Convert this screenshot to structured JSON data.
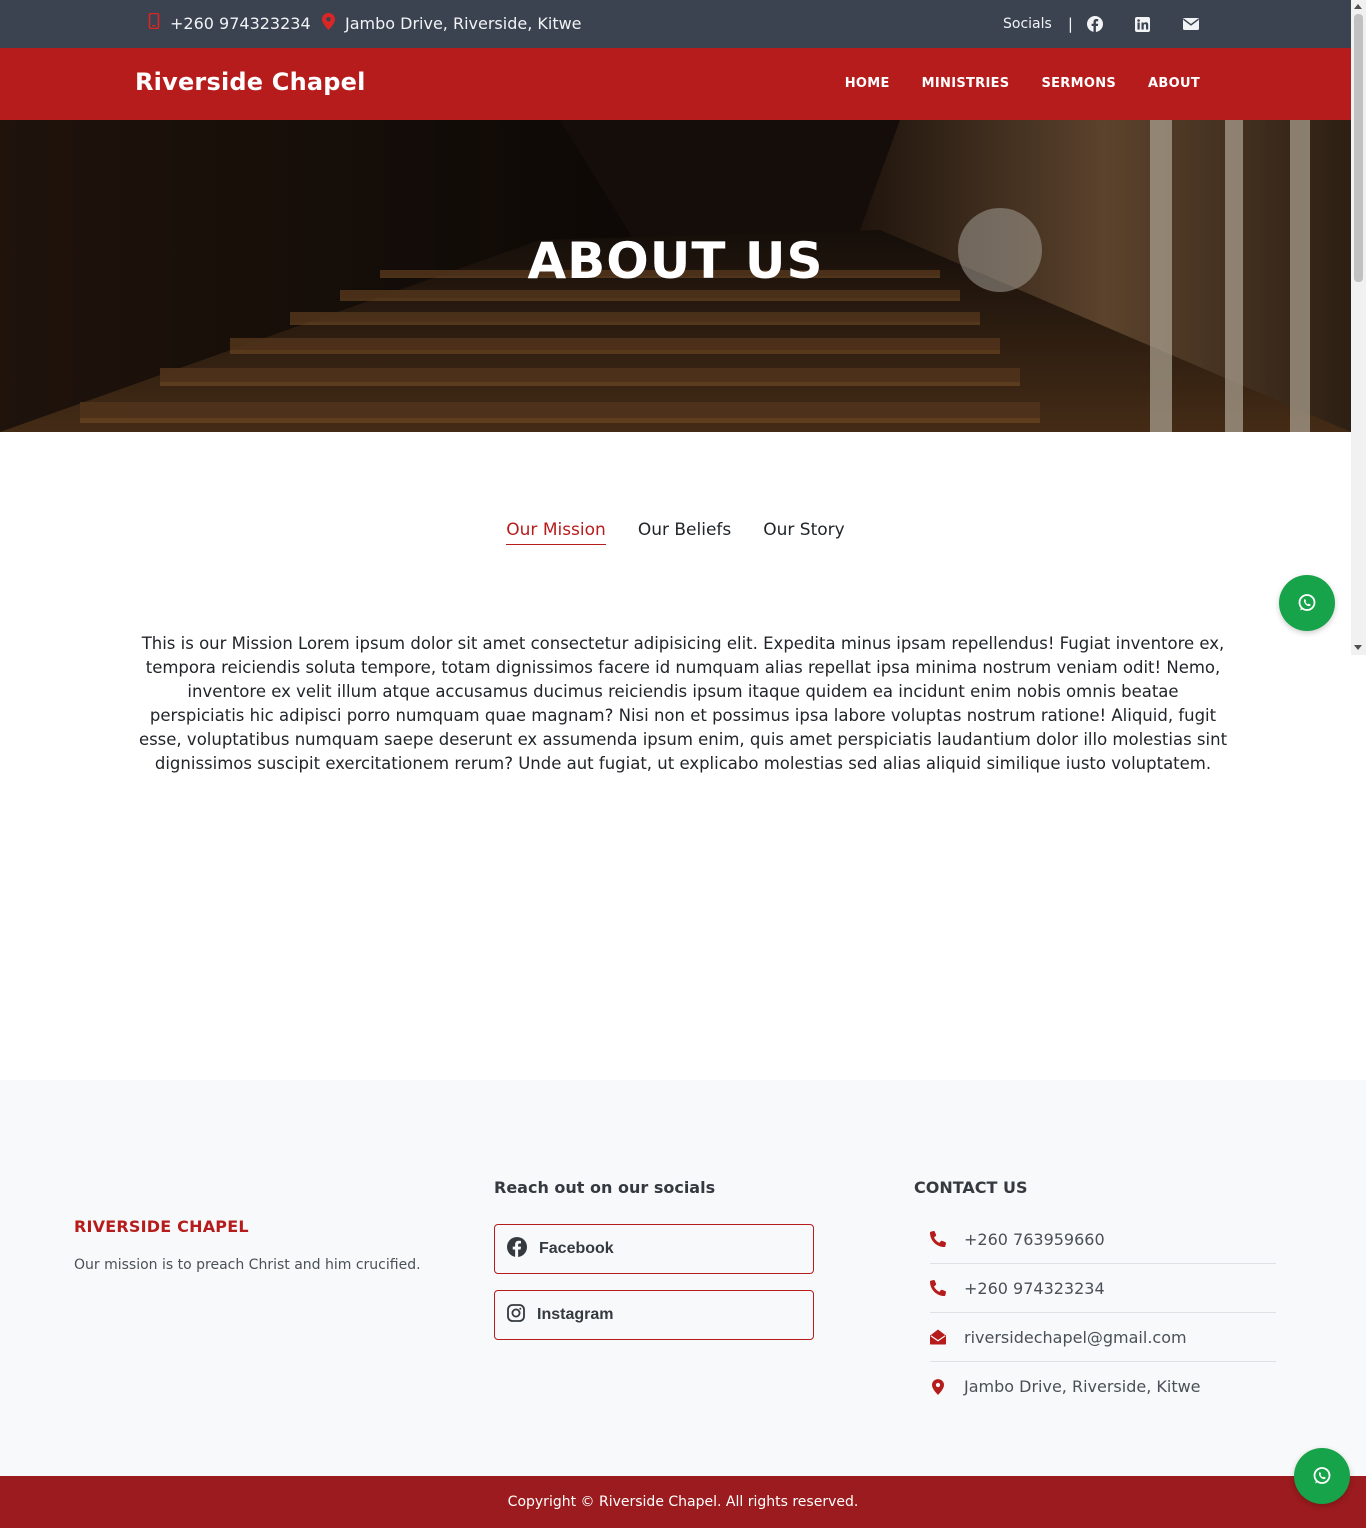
{
  "topbar": {
    "phone": "+260 974323234",
    "address": "Jambo Drive, Riverside, Kitwe",
    "socials_label": "Socials",
    "separator": "|",
    "icons": [
      "facebook-icon",
      "linkedin-icon",
      "envelope-icon"
    ]
  },
  "navbar": {
    "brand": "Riverside Chapel",
    "links": [
      "HOME",
      "MINISTRIES",
      "SERMONS",
      "ABOUT"
    ]
  },
  "hero": {
    "title": "ABOUT US"
  },
  "tabs": {
    "items": [
      "Our Mission",
      "Our Beliefs",
      "Our Story"
    ],
    "active": "Our Mission"
  },
  "mission_text": "This is our Mission Lorem ipsum dolor sit amet consectetur adipisicing elit. Expedita minus ipsam repellendus! Fugiat inventore ex, tempora reiciendis soluta tempore, totam dignissimos facere id numquam alias repellat ipsa minima nostrum veniam odit! Nemo, inventore ex velit illum atque accusamus ducimus reiciendis ipsum itaque quidem ea incidunt enim nobis omnis beatae perspiciatis hic adipisci porro numquam quae magnam? Nisi non et possimus ipsa labore voluptas nostrum ratione! Aliquid, fugit esse, voluptatibus numquam saepe deserunt ex assumenda ipsum enim, quis amet perspiciatis laudantium dolor illo molestias sint dignissimos suscipit exercitationem rerum? Unde aut fugiat, ut explicabo molestias sed alias aliquid similique iusto voluptatem.",
  "footer": {
    "brand": "RIVERSIDE CHAPEL",
    "description": "Our mission is to preach Christ and him crucified.",
    "socials_title": "Reach out on our socials",
    "social_buttons": [
      "Facebook",
      "Instagram"
    ],
    "contact_title": "CONTACT US",
    "contacts": [
      {
        "icon": "phone-icon",
        "text": "+260 763959660"
      },
      {
        "icon": "phone-icon",
        "text": "+260 974323234"
      },
      {
        "icon": "envelope-open-icon",
        "text": "riversidechapel@gmail.com"
      },
      {
        "icon": "map-marker-icon",
        "text": "Jambo Drive, Riverside, Kitwe"
      }
    ],
    "copyright": "Copyright © Riverside Chapel. All rights reserved."
  },
  "colors": {
    "topbar_bg": "#3b4250",
    "brand_red": "#b71c1c",
    "footer_bar": "#9b1b1e",
    "whatsapp_green": "#16a34a"
  }
}
